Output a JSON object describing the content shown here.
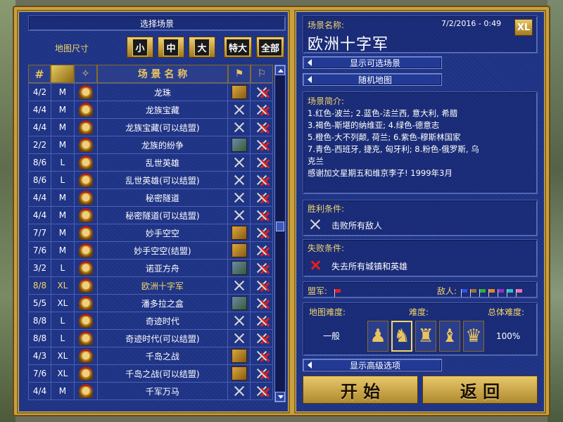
{
  "left": {
    "title": "选择场景",
    "map_size_label": "地图尺寸",
    "size_buttons": [
      "小",
      "中",
      "大",
      "特大",
      "全部"
    ],
    "columns": {
      "players": "#",
      "name": "场 景 名 称"
    }
  },
  "scenarios": [
    {
      "players": "4/2",
      "size": "M",
      "name": "龙珠",
      "victory": "gold-box",
      "loss": "redx"
    },
    {
      "players": "4/4",
      "size": "M",
      "name": "龙族宝藏",
      "victory": "swords",
      "loss": "redx"
    },
    {
      "players": "4/4",
      "size": "M",
      "name": "龙族宝藏(可以结盟)",
      "victory": "swords",
      "loss": "redx"
    },
    {
      "players": "2/2",
      "size": "M",
      "name": "龙族的纷争",
      "victory": "map-box",
      "loss": "redx"
    },
    {
      "players": "8/6",
      "size": "L",
      "name": "乱世英雄",
      "victory": "swords",
      "loss": "redx"
    },
    {
      "players": "8/6",
      "size": "L",
      "name": "乱世英雄(可以结盟)",
      "victory": "swords",
      "loss": "redx"
    },
    {
      "players": "4/4",
      "size": "M",
      "name": "秘密隧道",
      "victory": "swords",
      "loss": "redx"
    },
    {
      "players": "4/4",
      "size": "M",
      "name": "秘密隧道(可以结盟)",
      "victory": "swords",
      "loss": "redx"
    },
    {
      "players": "7/7",
      "size": "M",
      "name": "妙手空空",
      "victory": "gold-box",
      "loss": "redx"
    },
    {
      "players": "7/6",
      "size": "M",
      "name": "妙手空空(结盟)",
      "victory": "gold-box",
      "loss": "redx"
    },
    {
      "players": "3/2",
      "size": "L",
      "name": "诺亚方舟",
      "victory": "map-box",
      "loss": "redx"
    },
    {
      "players": "8/8",
      "size": "XL",
      "name": "欧洲十字军",
      "victory": "swords",
      "loss": "redx",
      "selected": true
    },
    {
      "players": "5/5",
      "size": "XL",
      "name": "潘多拉之盒",
      "victory": "map-box",
      "loss": "redx"
    },
    {
      "players": "8/8",
      "size": "L",
      "name": "奇迹时代",
      "victory": "swords",
      "loss": "redx"
    },
    {
      "players": "8/8",
      "size": "L",
      "name": "奇迹时代(可以结盟)",
      "victory": "swords",
      "loss": "redx"
    },
    {
      "players": "4/3",
      "size": "XL",
      "name": "千岛之战",
      "victory": "gold-box",
      "loss": "redx"
    },
    {
      "players": "7/6",
      "size": "XL",
      "name": "千岛之战(可以结盟)",
      "victory": "gold-box",
      "loss": "redx"
    },
    {
      "players": "4/4",
      "size": "M",
      "name": "千军万马",
      "victory": "swords",
      "loss": "redx"
    }
  ],
  "right": {
    "scenario_name_label": "场景名称:",
    "timestamp": "7/2/2016 - 0:49",
    "size_badge": "XL",
    "scenario_name": "欧洲十字军",
    "show_button": "显示可选场景",
    "random_button": "随机地图",
    "description_label": "场景简介:",
    "description_lines": [
      "1.红色-波兰; 2.蓝色-法兰西, 意大利, 希腊",
      "3.褐色-斯堪的纳维亚; 4.绿色-德意志",
      "5.橙色-大不列颠, 荷兰; 6.紫色-穆斯林国家",
      "7.青色-西班牙, 捷克, 匈牙利; 8.粉色-俄罗斯, 乌",
      "克兰",
      "感谢加文星期五和维京李子! 1999年3月"
    ],
    "victory_label": "胜利条件:",
    "victory_text": "击败所有敌人",
    "loss_label": "失败条件:",
    "loss_text": "失去所有城镇和英雄",
    "allies_label": "盟军:",
    "enemies_label": "敌人:",
    "ally_colors": [
      "#e02020"
    ],
    "enemy_colors": [
      "#3050e0",
      "#a07030",
      "#30b030",
      "#f08020",
      "#9030c0",
      "#30c0c0",
      "#f070b0"
    ],
    "map_difficulty_label": "地图难度:",
    "map_difficulty_value": "一般",
    "difficulty_label": "难度:",
    "overall_label": "总体难度:",
    "overall_value": "100%",
    "difficulty_pieces": [
      "♟",
      "♞",
      "♜",
      "♝",
      "♛"
    ],
    "selected_difficulty_index": 1,
    "advanced_button": "显示高级选项",
    "start_button": "开 始",
    "back_button": "返 回"
  }
}
